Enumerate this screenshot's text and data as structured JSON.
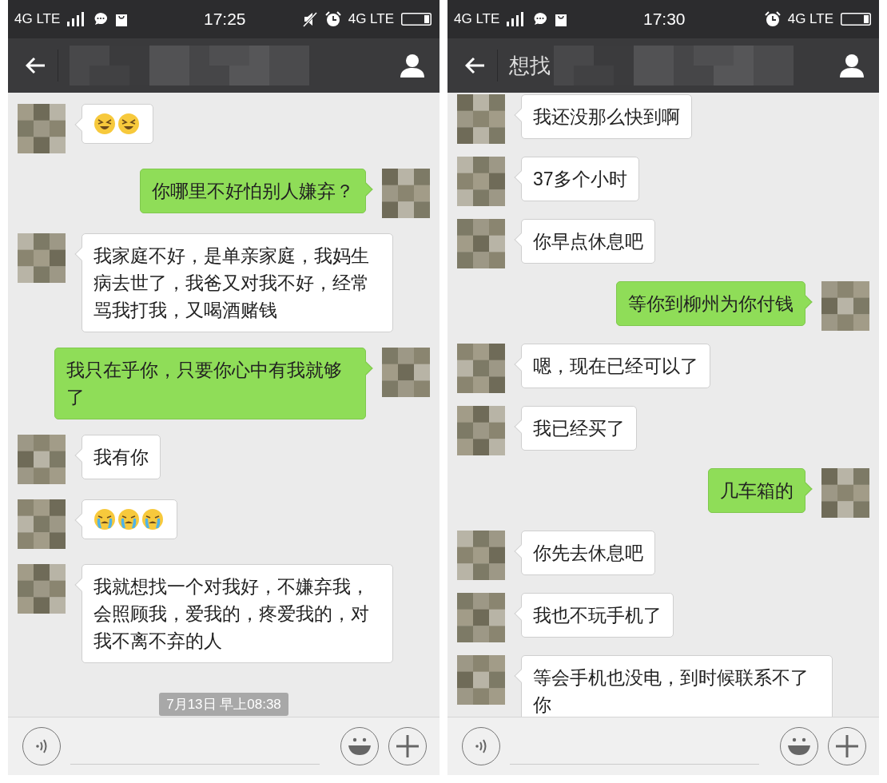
{
  "screens": [
    {
      "status_bar": {
        "network_left": "4G LTE",
        "time": "17:25",
        "muted": true,
        "network_right": "4G LTE"
      },
      "messages": [
        {
          "kind": "sticker",
          "emoji": [
            {
              "kind": "laugh"
            },
            {
              "kind": "laugh"
            }
          ]
        },
        {
          "kind": "outgoing",
          "text": "你哪里不好怕别人嫌弃？"
        },
        {
          "kind": "incoming",
          "text": "我家庭不好，是单亲家庭，我妈生病去世了，我爸又对我不好，经常骂我打我，又喝酒赌钱"
        },
        {
          "kind": "outgoing",
          "text": "我只在乎你，只要你心中有我就够了"
        },
        {
          "kind": "incoming",
          "text": "我有你"
        },
        {
          "kind": "sticker",
          "emoji": [
            {
              "kind": "cry"
            },
            {
              "kind": "cry"
            },
            {
              "kind": "cry"
            }
          ]
        },
        {
          "kind": "incoming",
          "text": "我就想找一个对我好，不嫌弃我，会照顾我，爱我的，疼爱我的，对我不离不弃的人"
        },
        {
          "kind": "timestamp",
          "text": "7月13日 早上08:38"
        }
      ]
    },
    {
      "status_bar": {
        "network_left": "4G LTE",
        "time": "17:30",
        "muted": false,
        "network_right": "4G LTE"
      },
      "header": {
        "title": "想找"
      },
      "messages": [
        {
          "kind": "incoming",
          "text": "我还没那么快到啊"
        },
        {
          "kind": "incoming",
          "text": "37多个小时"
        },
        {
          "kind": "incoming",
          "text": "你早点休息吧"
        },
        {
          "kind": "outgoing",
          "text": "等你到柳州为你付钱"
        },
        {
          "kind": "incoming",
          "text": "嗯，现在已经可以了"
        },
        {
          "kind": "incoming",
          "text": "我已经买了"
        },
        {
          "kind": "outgoing",
          "text": "几车箱的"
        },
        {
          "kind": "incoming",
          "text": "你先去休息吧"
        },
        {
          "kind": "incoming",
          "text": "我也不玩手机了"
        },
        {
          "kind": "incoming",
          "text": "等会手机也没电，到时候联系不了你"
        }
      ]
    }
  ]
}
